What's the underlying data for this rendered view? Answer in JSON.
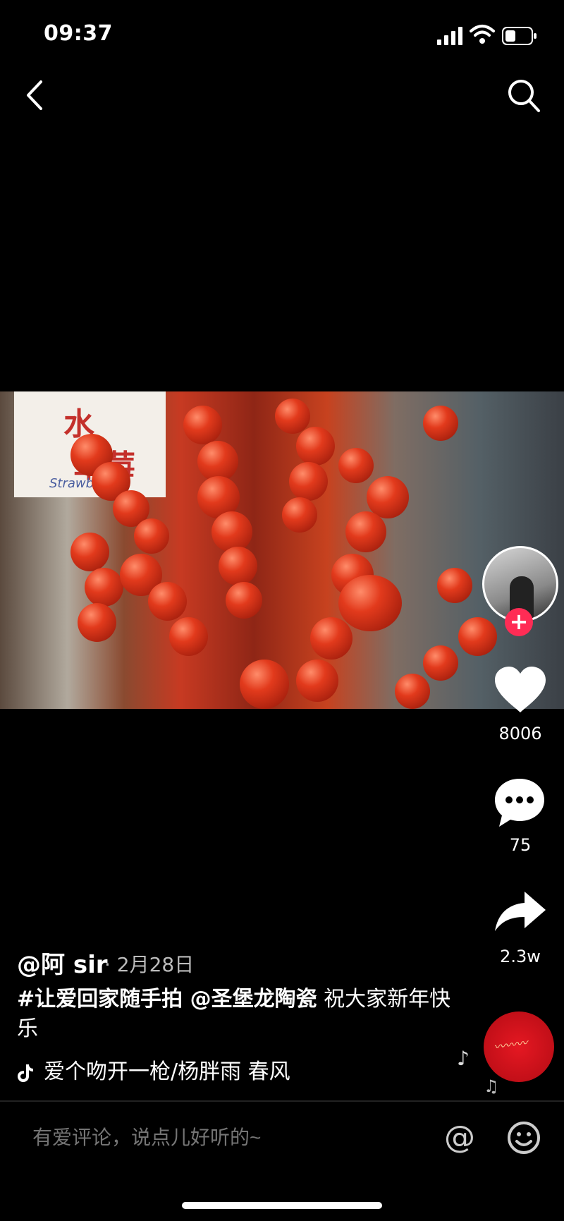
{
  "status_bar": {
    "time": "09:37"
  },
  "nav": {
    "back_icon": "chevron-left-icon",
    "search_icon": "search-icon"
  },
  "video": {
    "sign_text_1": "水",
    "sign_text_2": "草莓",
    "sign_text_eng": "Strawberry"
  },
  "actions": {
    "likes": "8006",
    "comments": "75",
    "shares": "2.3w",
    "follow_label": "+"
  },
  "post": {
    "author": "@阿 sir",
    "date": "· 2月28日",
    "tags": "#让爱回家随手拍 @圣堡龙陶瓷",
    "description": "祝大家新年快乐",
    "music": "爱个吻开一枪/杨胖雨    春风"
  },
  "comment_bar": {
    "placeholder": "有爱评论，说点儿好听的~",
    "at_label": "@"
  },
  "colors": {
    "accent": "#ff2c55",
    "background": "#000000"
  }
}
